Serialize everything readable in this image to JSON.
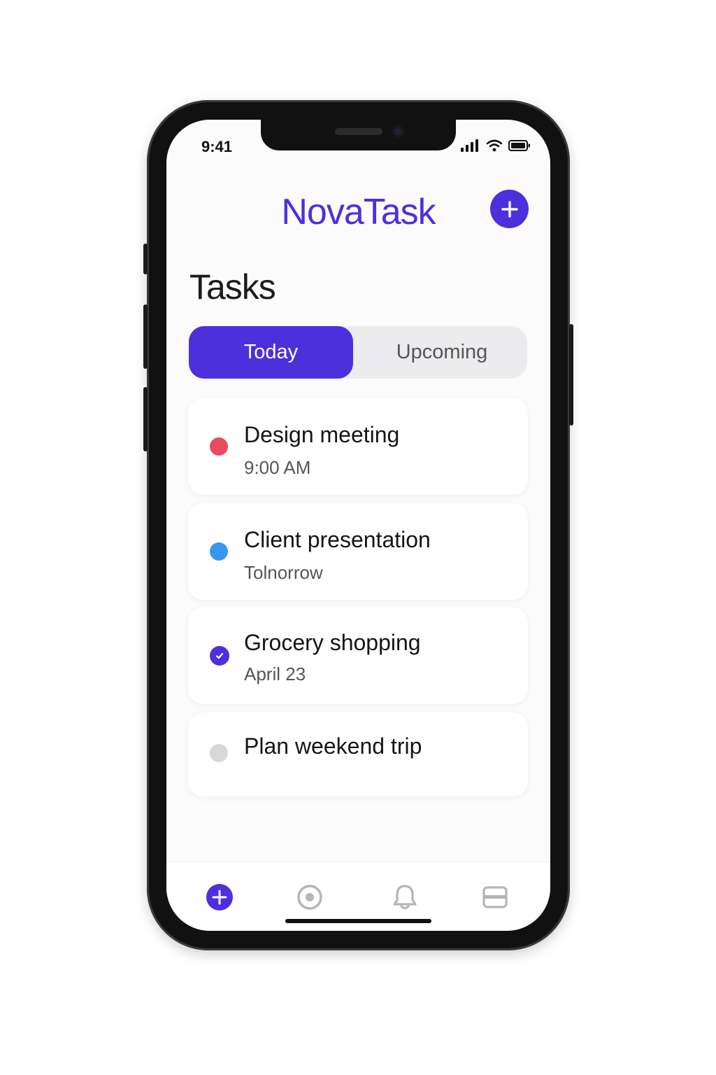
{
  "status_bar": {
    "time": "9:41"
  },
  "header": {
    "app_title": "NovaTask",
    "add_button_icon": "plus-icon"
  },
  "section": {
    "title": "Tasks"
  },
  "tabs": [
    {
      "label": "Today",
      "selected": true
    },
    {
      "label": "Upcoming",
      "selected": false
    }
  ],
  "tasks": [
    {
      "title": "Design meeting",
      "subtitle": "9:00 AM",
      "status": "red-dot",
      "color": "#e84a5f"
    },
    {
      "title": "Client presentation",
      "subtitle": "Tolnorrow",
      "status": "blue-dot",
      "color": "#3a97f0"
    },
    {
      "title": "Grocery shopping",
      "subtitle": "April 23",
      "status": "checked",
      "color": "#4b30dc"
    },
    {
      "title": "Plan weekend trip",
      "subtitle": "",
      "status": "gray-dot",
      "color": "#d8d8da"
    }
  ],
  "bottom_nav": [
    {
      "icon": "add-circle-icon",
      "active": true
    },
    {
      "icon": "target-icon",
      "active": false
    },
    {
      "icon": "bell-icon",
      "active": false
    },
    {
      "icon": "card-icon",
      "active": false
    }
  ],
  "colors": {
    "accent": "#4b30dc",
    "inactive_icon": "#b5b5b8"
  }
}
